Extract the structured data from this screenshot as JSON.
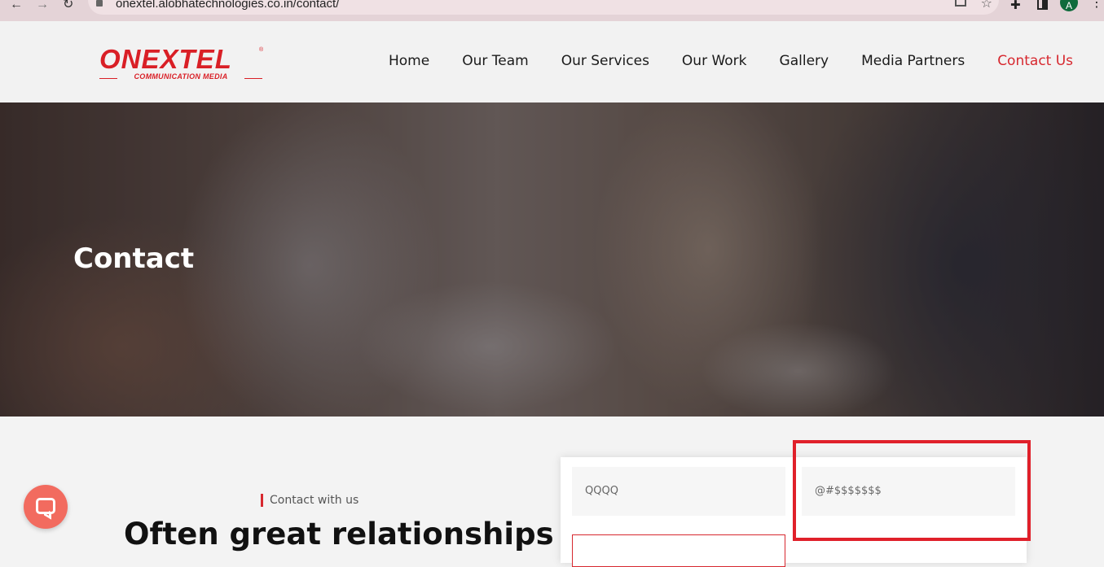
{
  "browser": {
    "url": "onextel.alobhatechnologies.co.in/contact/",
    "avatar_initial": "A"
  },
  "logo": {
    "main": "ONEXTEL",
    "registered": "®",
    "sub": "COMMUNICATION MEDIA"
  },
  "nav": {
    "items": [
      {
        "label": "Home"
      },
      {
        "label": "Our Team"
      },
      {
        "label": "Our Services"
      },
      {
        "label": "Our Work"
      },
      {
        "label": "Gallery"
      },
      {
        "label": "Media Partners"
      },
      {
        "label": "Contact Us",
        "active": true
      }
    ]
  },
  "hero": {
    "title": "Contact"
  },
  "section": {
    "eyebrow": "Contact with us",
    "headline": "Often great relationships"
  },
  "form": {
    "name_value": "QQQQ",
    "email_value": "@#$$$$$$$"
  },
  "colors": {
    "brand_red": "#d7282f",
    "highlight_red": "#e0202a",
    "chat_button": "#f26b5f"
  }
}
